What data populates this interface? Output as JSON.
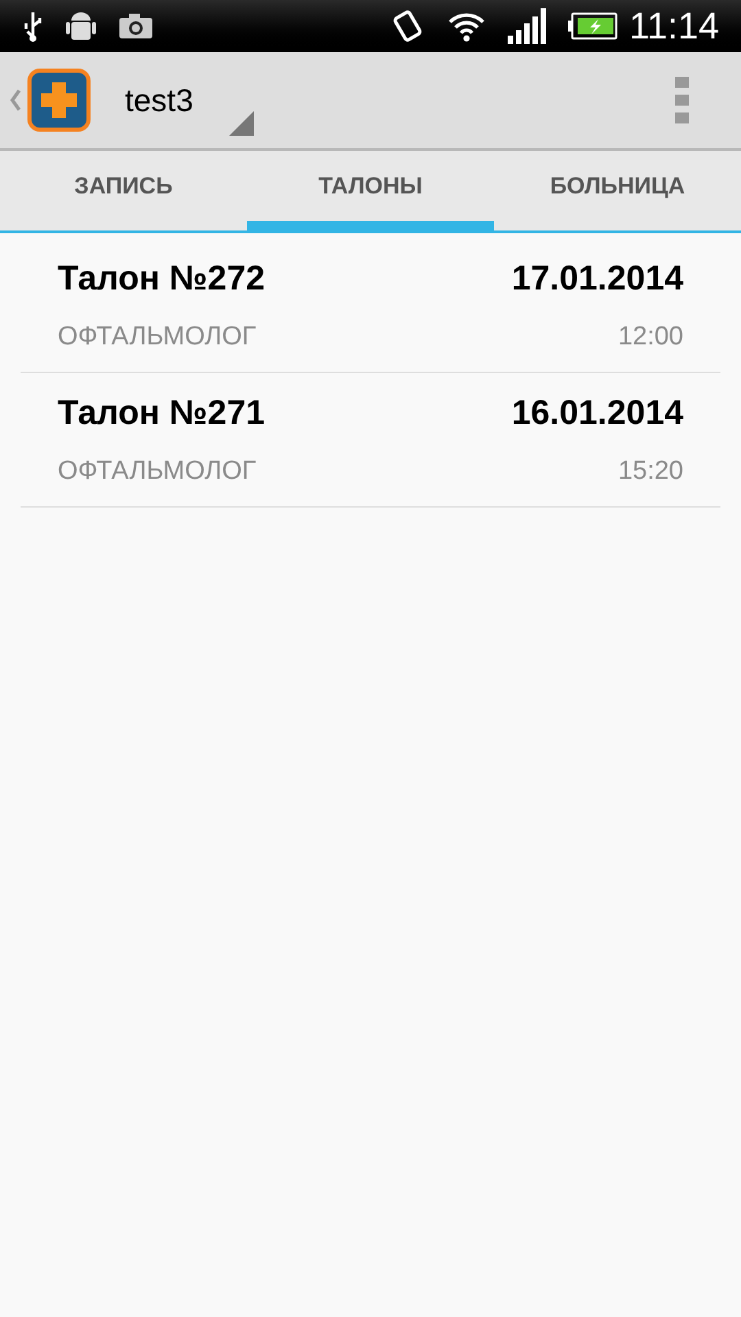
{
  "status_bar": {
    "time": "11:14"
  },
  "action_bar": {
    "title": "test3"
  },
  "tabs": [
    {
      "label": "ЗАПИСЬ",
      "selected": false
    },
    {
      "label": "ТАЛОНЫ",
      "selected": true
    },
    {
      "label": "БОЛЬНИЦА",
      "selected": false
    }
  ],
  "tickets": [
    {
      "title": "Талон №272",
      "date": "17.01.2014",
      "specialty": "ОФТАЛЬМОЛОГ",
      "time": "12:00"
    },
    {
      "title": "Талон №271",
      "date": "16.01.2014",
      "specialty": "ОФТАЛЬМОЛОГ",
      "time": "15:20"
    }
  ]
}
